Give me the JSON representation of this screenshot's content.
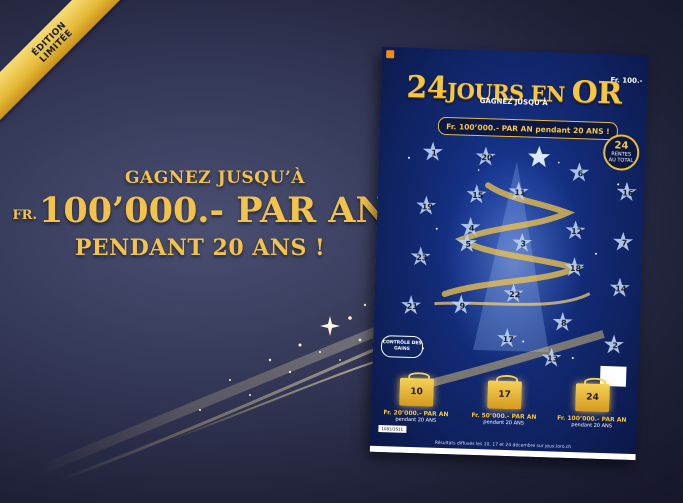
{
  "ribbon": {
    "line1": "ÉDITION",
    "line2": "LIMITÉE"
  },
  "headline": {
    "line1": "GAGNEZ JUSQU’À",
    "currency": "FR.",
    "amount": "100’000.- PAR AN",
    "line3": "PENDANT 20 ANS !"
  },
  "ticket": {
    "price": "Fr. 100.-",
    "title_part1": "24",
    "title_part2": "JOURS EN ",
    "title_part3": "OR",
    "subtitle": "GAGNEZ JUSQU’À",
    "prize_banner": "Fr. 100’000.- PAR AN pendant 20 ANS !",
    "rentes_number": "24",
    "rentes_label": "RENTES",
    "rentes_total": "AU TOTAL",
    "controle": "CONTRÔLE DES GAINS",
    "numbers": [
      "1",
      "20",
      "11",
      "6",
      "16",
      "15",
      "19",
      "4",
      "12",
      "7",
      "23",
      "5",
      "3",
      "18",
      "22",
      "14",
      "21",
      "9",
      "8",
      "2",
      "13",
      "17",
      "10",
      "24"
    ],
    "gifts": [
      {
        "day": "10",
        "amount": "Fr. 20’000.- PAR AN",
        "duration": "pendant 20 ANS"
      },
      {
        "day": "17",
        "amount": "Fr. 50’000.- PAR AN",
        "duration": "pendant 20 ANS"
      },
      {
        "day": "24",
        "amount": "Fr. 100’000.- PAR AN",
        "duration": "pendant 20 ANS"
      }
    ],
    "code": "1083/3S11",
    "footer": "Résultats diffusés les 10, 17 et 24 décembre sur jeux.loro.ch"
  },
  "colors": {
    "gold": "#f3c24a",
    "background": "#2c3050",
    "ticket_blue": "#122a74"
  }
}
